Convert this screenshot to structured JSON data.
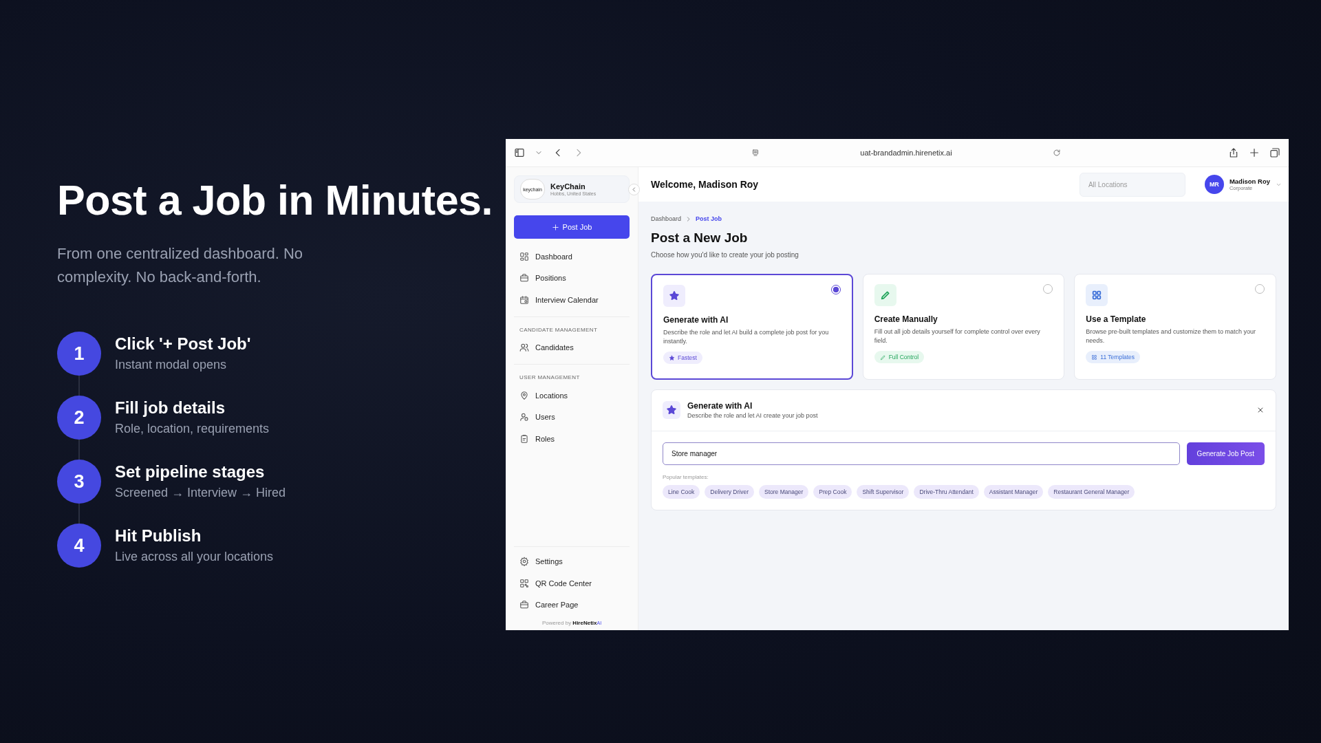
{
  "intro": {
    "title": "Post a Job in Minutes.",
    "subtitle": "From one centralized dashboard. No complexity. No back-and-forth."
  },
  "steps": [
    {
      "number": "1",
      "title": "Click '+ Post Job'",
      "subtitle": "Instant modal opens"
    },
    {
      "number": "2",
      "title": "Fill job details",
      "subtitle": "Role, location, requirements"
    },
    {
      "number": "3",
      "title": "Set pipeline stages",
      "subtitle": "Screened → Interview → Hired"
    },
    {
      "number": "4",
      "title": "Hit Publish",
      "subtitle": "Live across all your locations"
    }
  ],
  "browser": {
    "url": "uat-brandadmin.hirenetix.ai"
  },
  "sidebar": {
    "brand": {
      "logo_text": "keychain",
      "name": "KeyChain",
      "location": "Hobbs, United States"
    },
    "post_button": "Post Job",
    "sections": [
      {
        "items": [
          {
            "kind": "grid",
            "label": "Dashboard"
          },
          {
            "kind": "bag",
            "label": "Positions"
          },
          {
            "kind": "calendar",
            "label": "Interview Calendar"
          }
        ]
      },
      {
        "heading": "CANDIDATE MANAGEMENT",
        "items": [
          {
            "kind": "people",
            "label": "Candidates"
          }
        ]
      },
      {
        "heading": "USER MANAGEMENT",
        "items": [
          {
            "kind": "pin",
            "label": "Locations"
          },
          {
            "kind": "user",
            "label": "Users"
          },
          {
            "kind": "clipboard",
            "label": "Roles"
          }
        ]
      }
    ],
    "bottom_items": [
      {
        "kind": "gear",
        "label": "Settings"
      },
      {
        "kind": "qr",
        "label": "QR Code Center"
      },
      {
        "kind": "bag",
        "label": "Career Page"
      }
    ],
    "footer": {
      "text": "Powered by",
      "brand": "HireNetix",
      "brand_suffix": "AI"
    }
  },
  "header": {
    "welcome": "Welcome, Madison Roy",
    "location_placeholder": "All Locations",
    "user": {
      "initials": "MR",
      "name": "Madison Roy",
      "role": "Corporate"
    }
  },
  "breadcrumb": [
    {
      "label": "Dashboard",
      "current": false
    },
    {
      "label": "Post Job",
      "current": true
    }
  ],
  "page": {
    "title": "Post a New Job",
    "subtitle": "Choose how you'd like to create your job posting"
  },
  "options": [
    {
      "kind": "ai",
      "color": "#5b48d6",
      "title": "Generate with AI",
      "description": "Describe the role and let AI build a complete job post for you instantly.",
      "tag": "Fastest",
      "selected": true
    },
    {
      "kind": "manual",
      "color": "#22a55b",
      "title": "Create Manually",
      "description": "Fill out all job details yourself for complete control over every field.",
      "tag": "Full Control",
      "selected": false
    },
    {
      "kind": "template",
      "color": "#3b6fd8",
      "title": "Use a Template",
      "description": "Browse pre-built templates and customize them to match your needs.",
      "tag": "11 Templates",
      "selected": false
    }
  ],
  "ai_panel": {
    "title": "Generate with AI",
    "subtitle": "Describe the role and let AI create your job post",
    "input": "Store manager",
    "button": "Generate Job Post",
    "templates_label": "Popular templates:",
    "templates": [
      "Line Cook",
      "Delivery Driver",
      "Store Manager",
      "Prep Cook",
      "Shift Supervisor",
      "Drive-Thru Attendant",
      "Assistant Manager",
      "Restaurant General Manager"
    ]
  }
}
